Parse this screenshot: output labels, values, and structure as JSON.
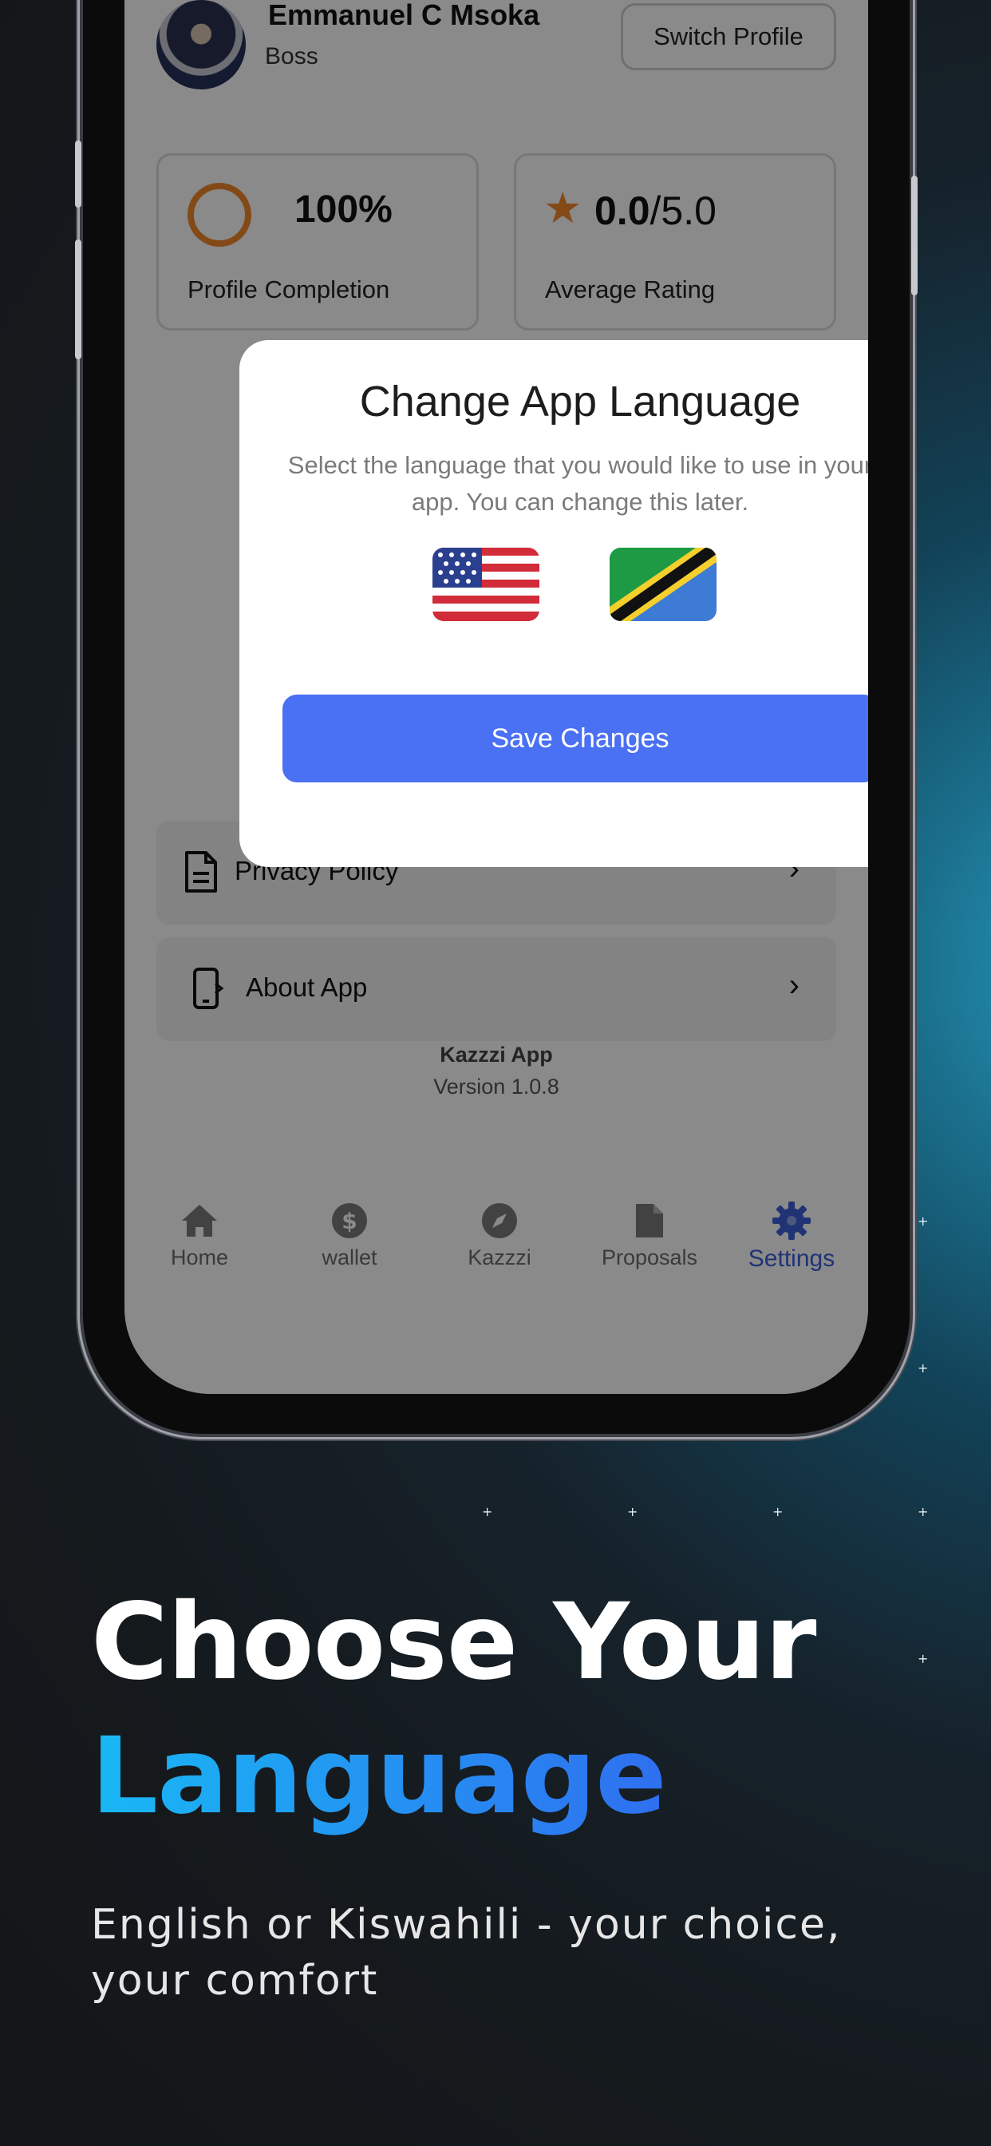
{
  "profile": {
    "name": "Emmanuel C Msoka",
    "role": "Boss",
    "switch_label": "Switch Profile"
  },
  "stats": {
    "completion_value": "100%",
    "completion_label": "Profile Completion",
    "rating_value": "0.0",
    "rating_max": "/5.0",
    "rating_label": "Average Rating"
  },
  "modal": {
    "title": "Change App Language",
    "subtitle": "Select the language that you would like to use in your app. You can change this later.",
    "languages": [
      "English (US flag)",
      "Kiswahili (Tanzania flag)"
    ],
    "save_label": "Save Changes"
  },
  "menu": {
    "privacy_label": "Privacy Policy",
    "about_label": "About App"
  },
  "app_info": {
    "name": "Kazzzi App",
    "version": "Version 1.0.8"
  },
  "nav": {
    "items": [
      {
        "label": "Home",
        "icon": "home-icon"
      },
      {
        "label": "wallet",
        "icon": "dollar-icon"
      },
      {
        "label": "Kazzzi",
        "icon": "compass-icon"
      },
      {
        "label": "Proposals",
        "icon": "document-icon"
      },
      {
        "label": "Settings",
        "icon": "gear-icon"
      }
    ],
    "active": "Settings"
  },
  "promo": {
    "headline_line1": "Choose Your",
    "headline_line2": "Language",
    "tagline": "English or Kiswahili - your choice, your comfort"
  },
  "colors": {
    "accent": "#4a70f3",
    "orange": "#f28a2e",
    "gradient_start": "#19b8f4",
    "gradient_end": "#2f6ff0"
  }
}
